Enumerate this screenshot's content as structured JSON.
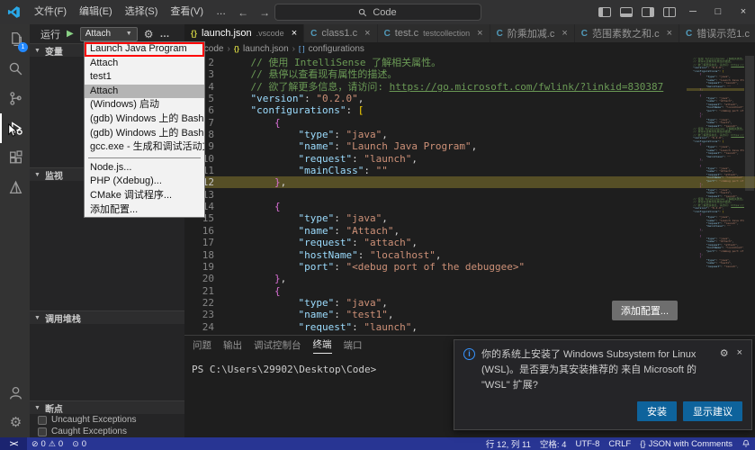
{
  "titlebar": {
    "search_label": "Code",
    "menus": [
      "文件(F)",
      "编辑(E)",
      "选择(S)",
      "查看(V)",
      "…"
    ]
  },
  "activity_bar": {
    "items": [
      "explorer",
      "search",
      "source-control",
      "run-and-debug",
      "extensions",
      "cmake"
    ],
    "bottom_items": [
      "account",
      "settings"
    ],
    "explorer_badge": "1"
  },
  "sidebar": {
    "title": "运行",
    "config_select": "Attach",
    "sections": {
      "variables": "变量",
      "watch": "监视",
      "call_stack": "调用堆栈",
      "breakpoints": "断点"
    },
    "breakpoint_items": [
      "Uncaught Exceptions",
      "Caught Exceptions"
    ]
  },
  "dropdown": {
    "items": [
      {
        "label": "Launch Java Program",
        "red_box": true
      },
      {
        "label": "Attach"
      },
      {
        "label": "test1"
      },
      {
        "label": "Attach",
        "selected": true
      },
      {
        "label": "(Windows) 启动"
      },
      {
        "label": "(gdb) Windows 上的 Bash 附加"
      },
      {
        "label": "(gdb) Windows 上的 Bash 附加"
      },
      {
        "label": "gcc.exe - 生成和调试活动文件"
      },
      {
        "separator": true
      },
      {
        "label": "Node.js..."
      },
      {
        "label": "PHP (Xdebug)..."
      },
      {
        "label": "CMake 调试程序..."
      },
      {
        "label": "添加配置..."
      }
    ]
  },
  "tabs": [
    {
      "label": "launch.json",
      "dir": ".vscode",
      "icon": "json",
      "active": true
    },
    {
      "label": "class1.c",
      "icon": "c"
    },
    {
      "label": "test.c",
      "dir": "testcollection",
      "icon": "c"
    },
    {
      "label": "阶乘加减.c",
      "icon": "c"
    },
    {
      "label": "范围素数之和.c",
      "icon": "c"
    },
    {
      "label": "错误示范1.c",
      "icon": "c"
    }
  ],
  "breadcrumb": {
    "items": [
      ".vscode",
      "launch.json",
      "configurations"
    ]
  },
  "editor": {
    "add_config": "添加配置...",
    "lines": [
      {
        "n": 2,
        "toks": [
          [
            "c",
            "    // 使用 IntelliSense 了解相关属性。"
          ]
        ]
      },
      {
        "n": 3,
        "toks": [
          [
            "c",
            "    // 悬停以查看现有属性的描述。"
          ]
        ]
      },
      {
        "n": 4,
        "toks": [
          [
            "c",
            "    // 欲了解更多信息，请访问: "
          ],
          [
            "lk",
            "https://go.microsoft.com/fwlink/?linkid=830387"
          ]
        ]
      },
      {
        "n": 5,
        "toks": [
          [
            "p",
            "    "
          ],
          [
            "k",
            "\"version\""
          ],
          [
            "p",
            ": "
          ],
          [
            "s",
            "\"0.2.0\""
          ],
          [
            "p",
            ","
          ]
        ]
      },
      {
        "n": 6,
        "toks": [
          [
            "p",
            "    "
          ],
          [
            "k",
            "\"configurations\""
          ],
          [
            "p",
            ": "
          ],
          [
            "b1",
            "["
          ]
        ]
      },
      {
        "n": 7,
        "toks": [
          [
            "p",
            "        "
          ],
          [
            "b2",
            "{"
          ]
        ]
      },
      {
        "n": 8,
        "toks": [
          [
            "p",
            "            "
          ],
          [
            "k",
            "\"type\""
          ],
          [
            "p",
            ": "
          ],
          [
            "s",
            "\"java\""
          ],
          [
            "p",
            ","
          ]
        ]
      },
      {
        "n": 9,
        "toks": [
          [
            "p",
            "            "
          ],
          [
            "k",
            "\"name\""
          ],
          [
            "p",
            ": "
          ],
          [
            "s",
            "\"Launch Java Program\""
          ],
          [
            "p",
            ","
          ]
        ]
      },
      {
        "n": 10,
        "toks": [
          [
            "p",
            "            "
          ],
          [
            "k",
            "\"request\""
          ],
          [
            "p",
            ": "
          ],
          [
            "s",
            "\"launch\""
          ],
          [
            "p",
            ","
          ]
        ]
      },
      {
        "n": 11,
        "toks": [
          [
            "p",
            "            "
          ],
          [
            "k",
            "\"mainClass\""
          ],
          [
            "p",
            ": "
          ],
          [
            "s",
            "\"\""
          ]
        ]
      },
      {
        "n": 12,
        "hl": true,
        "toks": [
          [
            "p",
            "        "
          ],
          [
            "b2",
            "}"
          ],
          [
            "p",
            ","
          ]
        ]
      },
      {
        "n": 13,
        "toks": []
      },
      {
        "n": 14,
        "toks": [
          [
            "p",
            "        "
          ],
          [
            "b2",
            "{"
          ]
        ]
      },
      {
        "n": 15,
        "toks": [
          [
            "p",
            "            "
          ],
          [
            "k",
            "\"type\""
          ],
          [
            "p",
            ": "
          ],
          [
            "s",
            "\"java\""
          ],
          [
            "p",
            ","
          ]
        ]
      },
      {
        "n": 16,
        "toks": [
          [
            "p",
            "            "
          ],
          [
            "k",
            "\"name\""
          ],
          [
            "p",
            ": "
          ],
          [
            "s",
            "\"Attach\""
          ],
          [
            "p",
            ","
          ]
        ]
      },
      {
        "n": 17,
        "toks": [
          [
            "p",
            "            "
          ],
          [
            "k",
            "\"request\""
          ],
          [
            "p",
            ": "
          ],
          [
            "s",
            "\"attach\""
          ],
          [
            "p",
            ","
          ]
        ]
      },
      {
        "n": 18,
        "toks": [
          [
            "p",
            "            "
          ],
          [
            "k",
            "\"hostName\""
          ],
          [
            "p",
            ": "
          ],
          [
            "s",
            "\"localhost\""
          ],
          [
            "p",
            ","
          ]
        ]
      },
      {
        "n": 19,
        "toks": [
          [
            "p",
            "            "
          ],
          [
            "k",
            "\"port\""
          ],
          [
            "p",
            ": "
          ],
          [
            "s",
            "\"<debug port of the debuggee>\""
          ]
        ]
      },
      {
        "n": 20,
        "toks": [
          [
            "p",
            "        "
          ],
          [
            "b2",
            "}"
          ],
          [
            "p",
            ","
          ]
        ]
      },
      {
        "n": 21,
        "toks": [
          [
            "p",
            "        "
          ],
          [
            "b2",
            "{"
          ]
        ]
      },
      {
        "n": 22,
        "toks": [
          [
            "p",
            "            "
          ],
          [
            "k",
            "\"type\""
          ],
          [
            "p",
            ": "
          ],
          [
            "s",
            "\"java\""
          ],
          [
            "p",
            ","
          ]
        ]
      },
      {
        "n": 23,
        "toks": [
          [
            "p",
            "            "
          ],
          [
            "k",
            "\"name\""
          ],
          [
            "p",
            ": "
          ],
          [
            "s",
            "\"test1\""
          ],
          [
            "p",
            ","
          ]
        ]
      },
      {
        "n": 24,
        "toks": [
          [
            "p",
            "            "
          ],
          [
            "k",
            "\"request\""
          ],
          [
            "p",
            ": "
          ],
          [
            "s",
            "\"launch\""
          ],
          [
            "p",
            ","
          ]
        ]
      }
    ]
  },
  "panel": {
    "tabs": [
      "问题",
      "输出",
      "调试控制台",
      "终端",
      "端口"
    ],
    "active_tab": "终端",
    "shell": "powershell",
    "prompt": "PS C:\\Users\\29902\\Desktop\\Code>"
  },
  "notification": {
    "message": "你的系统上安装了 Windows Subsystem for Linux (WSL)。是否要为其安装推荐的 来自 Microsoft 的 \"WSL\" 扩展?",
    "install": "安装",
    "show_recommend": "显示建议"
  },
  "status_bar": {
    "errors": "0",
    "warnings": "0",
    "ports": "0",
    "cursor_position": "行 12, 列 11",
    "indentation": "空格: 4",
    "encoding": "UTF-8",
    "eol": "CRLF",
    "language_icon": "{}",
    "language": "JSON with Comments"
  },
  "colors": {
    "status_bar": "#283593",
    "accent_button": "#0e639c",
    "line_highlight": "#564f26",
    "activity_badge": "#2188ff"
  }
}
